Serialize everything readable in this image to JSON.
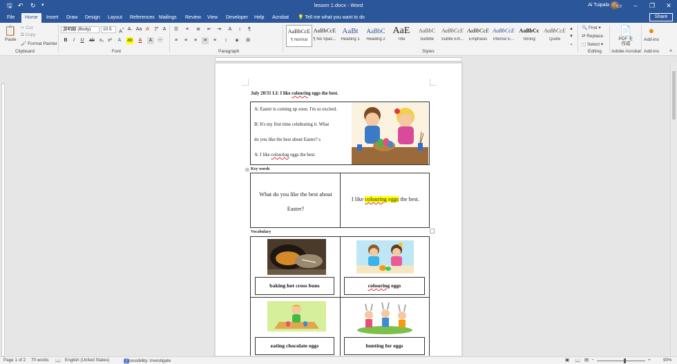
{
  "app": {
    "doc_title": "lesson 1.docx  -  Word",
    "user_name": "Ai Tuipala",
    "share_label": "Share",
    "tell_me": "Tell me what you want to do"
  },
  "tabs": [
    "File",
    "Home",
    "Insert",
    "Draw",
    "Design",
    "Layout",
    "References",
    "Mailings",
    "Review",
    "View",
    "Developer",
    "Help",
    "Acrobat"
  ],
  "ribbon": {
    "clipboard": {
      "label": "Clipboard",
      "paste": "Paste",
      "cut": "Cut",
      "copy": "Copy",
      "format_painter": "Format Painter"
    },
    "font": {
      "label": "Font",
      "family": "游明朝 (Body)",
      "size": "10.5"
    },
    "paragraph": {
      "label": "Paragraph"
    },
    "styles": {
      "label": "Styles",
      "items": [
        {
          "sample": "AaBbCcE",
          "name": "¶ Normal"
        },
        {
          "sample": "AaBbCcE",
          "name": "¶ No Spac..."
        },
        {
          "sample": "AaBt",
          "name": "Heading 1"
        },
        {
          "sample": "AaBbC",
          "name": "Heading 2"
        },
        {
          "sample": "AaE",
          "name": "Title"
        },
        {
          "sample": "AaBbC",
          "name": "Subtitle"
        },
        {
          "sample": "AaBbCcE",
          "name": "Subtle Em..."
        },
        {
          "sample": "AaBbCcE",
          "name": "Emphasis"
        },
        {
          "sample": "AaBbCcE",
          "name": "Intense E..."
        },
        {
          "sample": "AaBbCc",
          "name": "Strong"
        },
        {
          "sample": "AaBbCcE",
          "name": "Quote"
        }
      ]
    },
    "editing": {
      "label": "Editing",
      "find": "Find",
      "replace": "Replace",
      "select": "Select"
    },
    "acrobat": {
      "label": "Adobe Acrobat",
      "pdf": "PDF を\n作成"
    },
    "addins": {
      "label": "Add-ins",
      "button": "Add-ins"
    }
  },
  "document": {
    "lesson_title_prefix": "July 20/31 LI:   I like ",
    "lesson_title_word": "colouring",
    "lesson_title_suffix": " eggs the best.",
    "dialog": {
      "line1": "A: Easter is coming up soon. I'm so excited.",
      "line2": "B: It's my first time celebrating it. What",
      "line3": "do you like the best about Easter? s",
      "line4_prefix": "A: I like ",
      "line4_word": "colouring",
      "line4_suffix": " eggs the best."
    },
    "key_words_label": "Key words",
    "key_question_line1": "What do you like the best about",
    "key_question_line2": "Easter?",
    "key_answer_prefix": "I like ",
    "key_answer_word": "colouring",
    "key_answer_mid": " eggs",
    "key_answer_suffix": " the best.",
    "vocabulary_label": "Vocabulary",
    "vocab": {
      "item1": "baking hot cross buns",
      "item2_word": "colouring",
      "item2_suffix": " eggs",
      "item3": "eating chocolate eggs",
      "item4": "hunting for eggs"
    }
  },
  "status": {
    "page": "Page 1 of 2",
    "words": "70 words",
    "language": "English (United States)",
    "accessibility": "Accessibility: Investigate",
    "zoom": "90%"
  }
}
